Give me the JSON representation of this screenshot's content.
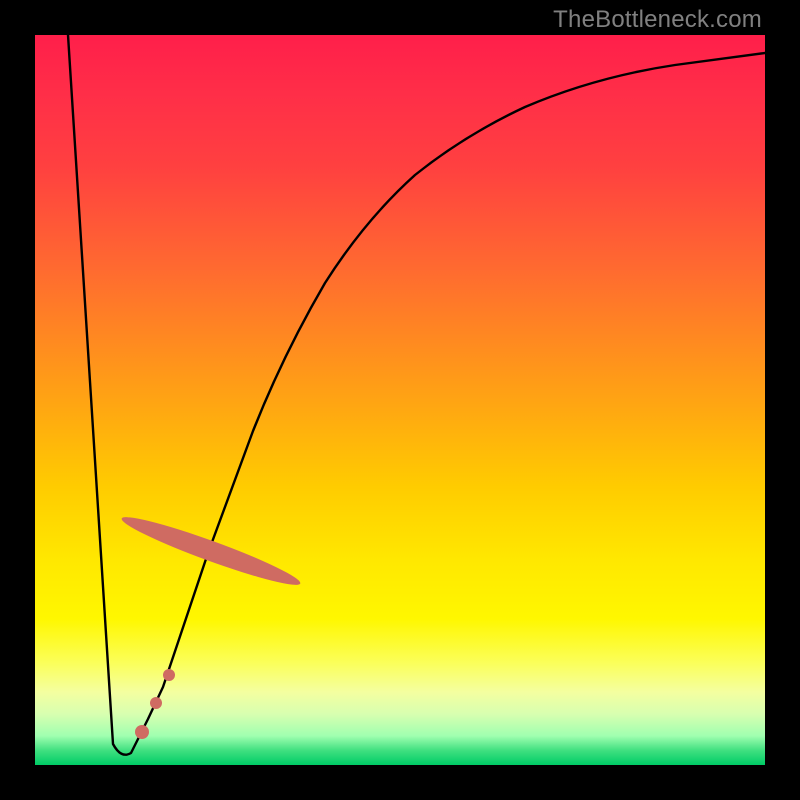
{
  "watermark": "TheBottleneck.com",
  "chart_data": {
    "type": "line",
    "title": "",
    "xlabel": "",
    "ylabel": "",
    "xlim": [
      0,
      100
    ],
    "ylim": [
      0,
      100
    ],
    "series": [
      {
        "name": "bottleneck-curve",
        "x": [
          4.5,
          10.7,
          13.2,
          15.5,
          17.5,
          23.7,
          29.9,
          39.7,
          52.1,
          67.1,
          80.8,
          100.0
        ],
        "y": [
          100.0,
          2.9,
          1.6,
          6.3,
          10.7,
          29.0,
          45.8,
          66.0,
          80.8,
          90.1,
          95.9,
          97.5
        ]
      }
    ],
    "markers": {
      "name": "highlighted-range",
      "x": [
        14.7,
        16.6,
        18.4,
        24.1
      ],
      "y": [
        4.5,
        8.5,
        12.3,
        29.3
      ]
    },
    "background": "rainbow-gradient (red top to green bottom)"
  },
  "colors": {
    "frame": "#000000",
    "curve": "#000000",
    "markers": "#cf6b62",
    "watermark": "#808080"
  }
}
